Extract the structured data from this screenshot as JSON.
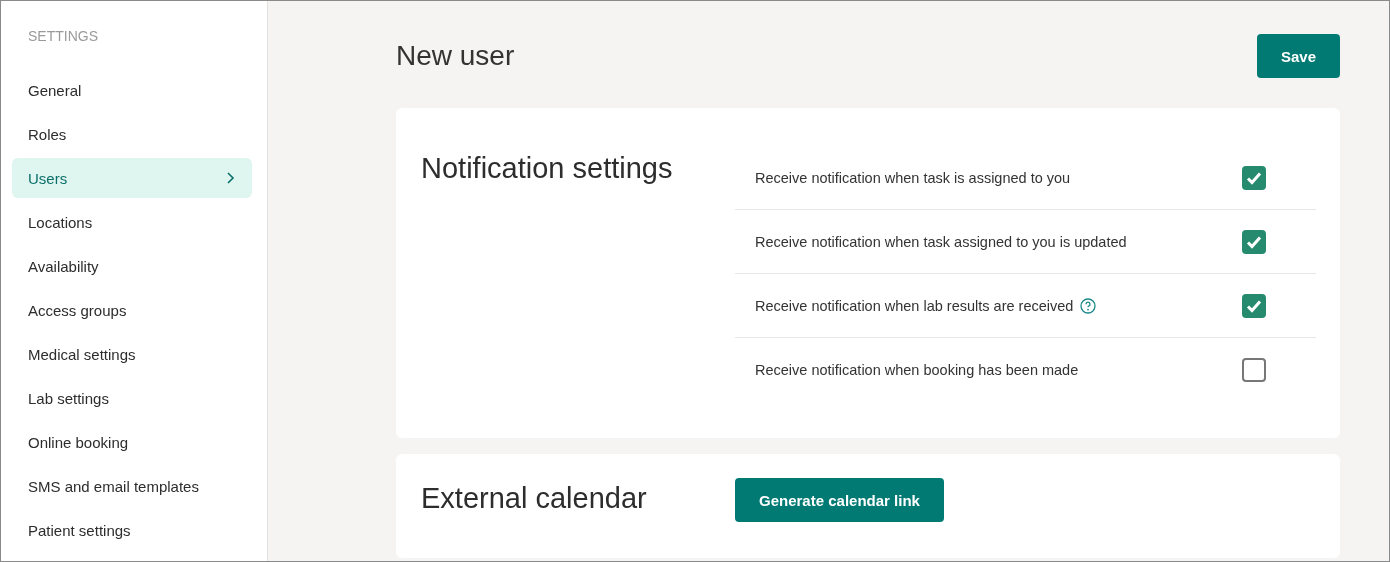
{
  "sidebar": {
    "heading": "SETTINGS",
    "items": [
      {
        "label": "General",
        "selected": false
      },
      {
        "label": "Roles",
        "selected": false
      },
      {
        "label": "Users",
        "selected": true
      },
      {
        "label": "Locations",
        "selected": false
      },
      {
        "label": "Availability",
        "selected": false
      },
      {
        "label": "Access groups",
        "selected": false
      },
      {
        "label": "Medical settings",
        "selected": false
      },
      {
        "label": "Lab settings",
        "selected": false
      },
      {
        "label": "Online booking",
        "selected": false
      },
      {
        "label": "SMS and email templates",
        "selected": false
      },
      {
        "label": "Patient settings",
        "selected": false
      }
    ]
  },
  "page": {
    "title": "New user",
    "save_button": "Save"
  },
  "notification_settings": {
    "title": "Notification settings",
    "options": [
      {
        "label": "Receive notification when task is assigned to you",
        "checked": true,
        "help": false
      },
      {
        "label": "Receive notification when task assigned to you is updated",
        "checked": true,
        "help": false
      },
      {
        "label": "Receive notification when lab results are received",
        "checked": true,
        "help": true
      },
      {
        "label": "Receive notification when booking has been made",
        "checked": false,
        "help": false
      }
    ]
  },
  "external_calendar": {
    "title": "External calendar",
    "button": "Generate calendar link"
  }
}
